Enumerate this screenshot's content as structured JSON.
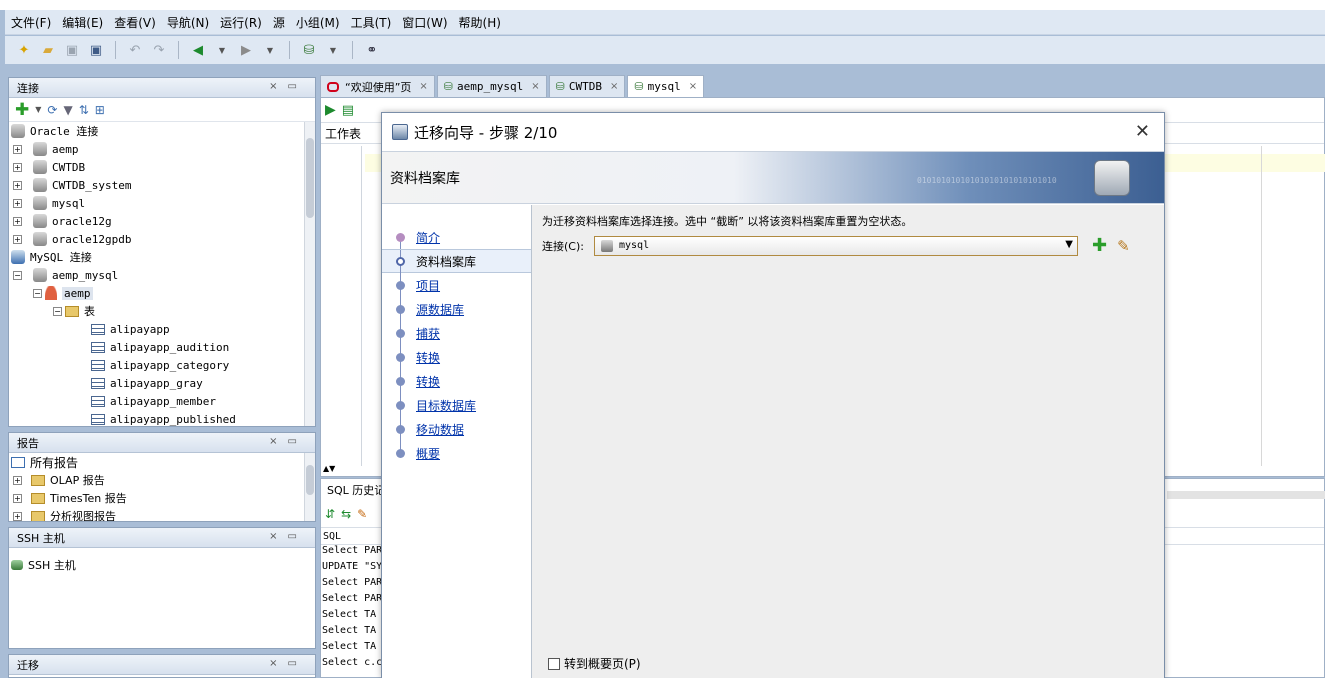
{
  "menu": [
    "文件(F)",
    "编辑(E)",
    "查看(V)",
    "导航(N)",
    "运行(R)",
    "源",
    "小组(M)",
    "工具(T)",
    "窗口(W)",
    "帮助(H)"
  ],
  "panels": {
    "connections": {
      "title": "连接",
      "oracle_root": "Oracle 连接",
      "oracle_items": [
        "aemp",
        "CWTDB",
        "CWTDB_system",
        "mysql",
        "oracle12g",
        "oracle12gpdb"
      ],
      "mysql_root": "MySQL 连接",
      "mysql_conn": "aemp_mysql",
      "mysql_schema": "aemp",
      "tables_folder": "表",
      "tables": [
        "alipayapp",
        "alipayapp_audition",
        "alipayapp_category",
        "alipayapp_gray",
        "alipayapp_member",
        "alipayapp_published"
      ]
    },
    "reports": {
      "title": "报告",
      "items": [
        "所有报告",
        "OLAP 报告",
        "TimesTen 报告",
        "分析视图报告"
      ]
    },
    "ssh": {
      "title": "SSH 主机",
      "item": "SSH 主机"
    },
    "migration": {
      "title": "迁移"
    }
  },
  "tabs": [
    "“欢迎使用”页",
    "aemp_mysql",
    "CWTDB",
    "mysql"
  ],
  "editor": {
    "worksheet_label": "工作表"
  },
  "sql_history": {
    "title": "SQL 历史记",
    "column": "SQL",
    "rows": [
      "Select PAR",
      "UPDATE \"SY",
      "Select PAR",
      "Select PAR",
      "Select  TA",
      "Select  TA",
      "Select  TA",
      "Select c.c"
    ]
  },
  "dialog": {
    "title": "迁移向导 - 步骤 2/10",
    "banner_title": "资料档案库",
    "banner_bits": "01010101010101010101010101010",
    "steps": [
      "简介",
      "资料档案库",
      "项目",
      "源数据库",
      "捕获",
      "转换",
      "转换",
      "目标数据库",
      "移动数据",
      "概要"
    ],
    "active_step": 1,
    "description": "为迁移资料档案库选择连接。选中 “截断” 以将该资料档案库重置为空状态。",
    "connection_label": "连接(C):",
    "connection_value": "mysql",
    "goto_summary_label": "转到概要页(P)"
  }
}
